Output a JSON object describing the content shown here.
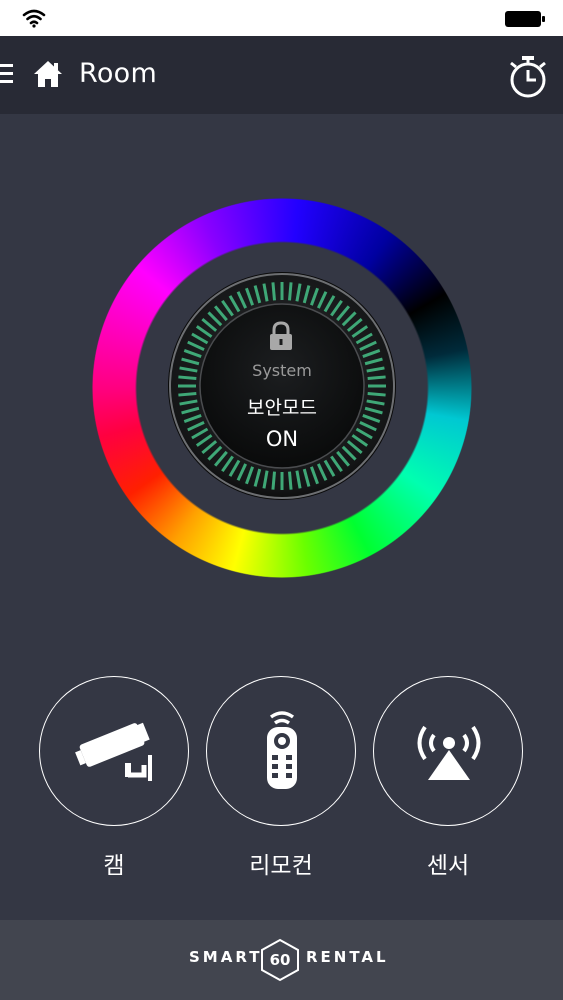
{
  "status_bar": {
    "wifi_icon": "wifi-icon",
    "battery_icon": "battery-full-icon"
  },
  "app_bar": {
    "menu_icon": "hamburger-menu-icon",
    "home_icon": "home-icon",
    "title": "Room",
    "timer_icon": "stopwatch-icon"
  },
  "security_dial": {
    "lock_icon": "lock-icon",
    "system_label": "System",
    "mode_label": "보안모드",
    "status": "ON"
  },
  "controls": [
    {
      "label": "캠",
      "icon": "security-camera-icon"
    },
    {
      "label": "리모컨",
      "icon": "remote-control-icon"
    },
    {
      "label": "센서",
      "icon": "sensor-signal-icon"
    }
  ],
  "footer": {
    "brand_left": "SMART",
    "brand_number": "60",
    "brand_right": "RENTAL"
  },
  "colors": {
    "background": "#343744",
    "app_bar": "#282a35",
    "footer": "#42454f",
    "dial_ticks": "#3fa877",
    "text": "#ffffff"
  }
}
